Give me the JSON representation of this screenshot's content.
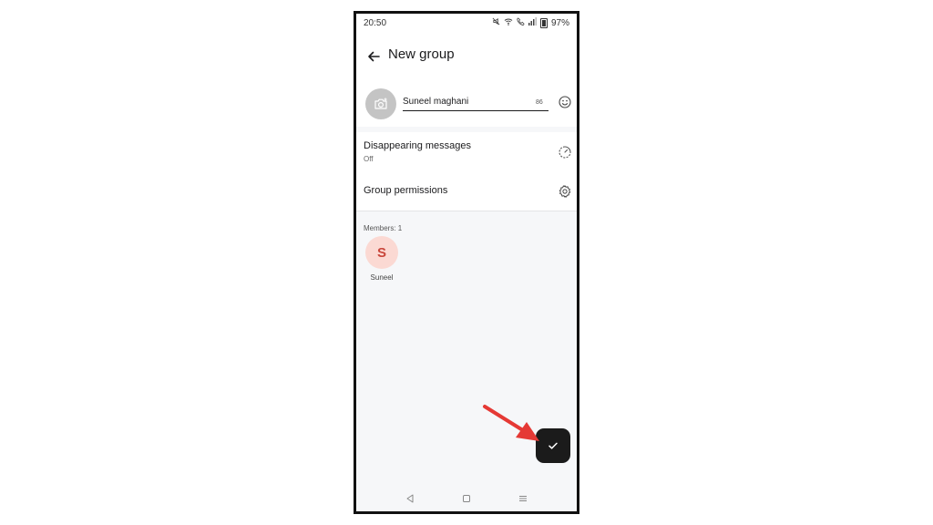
{
  "status_bar": {
    "time": "20:50",
    "battery": "97%",
    "icons": [
      "mute-icon",
      "wifi-icon",
      "call-icon",
      "signal-icon",
      "battery-icon"
    ]
  },
  "app_bar": {
    "title": "New group",
    "back_icon": "arrow-left-icon"
  },
  "group_name": {
    "value": "Suneel maghani",
    "counter": "86",
    "avatar_icon": "camera-add-icon",
    "emoji_icon": "smiley-icon"
  },
  "settings": {
    "disappearing": {
      "title": "Disappearing messages",
      "subtitle": "Off",
      "icon": "timer-icon"
    },
    "permissions": {
      "title": "Group permissions",
      "icon": "gear-icon"
    }
  },
  "members": {
    "label": "Members: 1",
    "items": [
      {
        "initial": "S",
        "name": "Suneel"
      }
    ]
  },
  "fab": {
    "icon": "checkmark-icon"
  },
  "nav_bar": {
    "icons": [
      "nav-back-icon",
      "nav-home-icon",
      "nav-recents-icon"
    ]
  },
  "colors": {
    "fab": "#1b1b1b",
    "member_avatar_bg": "#fbd9d3",
    "member_avatar_text": "#c9463b",
    "annotation_arrow": "#e53935"
  }
}
